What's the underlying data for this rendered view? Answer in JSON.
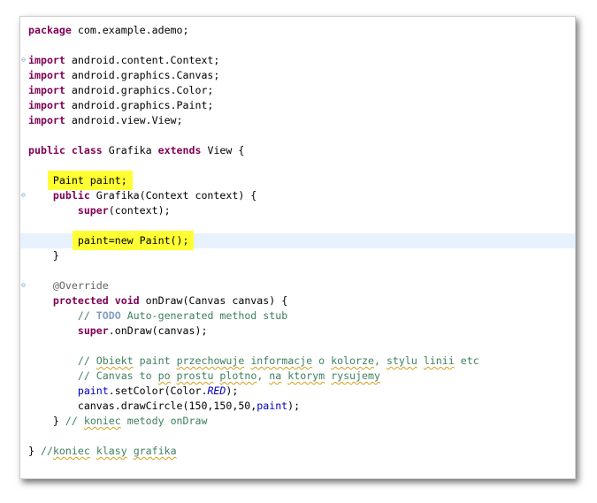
{
  "editor": {
    "lines": [
      [
        {
          "t": "package",
          "c": "kw"
        },
        {
          "t": " com.example.ademo;"
        }
      ],
      [],
      [
        {
          "t": "import",
          "c": "kw"
        },
        {
          "t": " android.content.Context;"
        }
      ],
      [
        {
          "t": "import",
          "c": "kw"
        },
        {
          "t": " android.graphics.Canvas;"
        }
      ],
      [
        {
          "t": "import",
          "c": "kw"
        },
        {
          "t": " android.graphics.Color;"
        }
      ],
      [
        {
          "t": "import",
          "c": "kw"
        },
        {
          "t": " android.graphics.Paint;"
        }
      ],
      [
        {
          "t": "import",
          "c": "kw"
        },
        {
          "t": " android.view.View;"
        }
      ],
      [],
      [
        {
          "t": "public",
          "c": "kw"
        },
        {
          "t": " "
        },
        {
          "t": "class",
          "c": "kw"
        },
        {
          "t": " Grafika "
        },
        {
          "t": "extends",
          "c": "kw"
        },
        {
          "t": " View {"
        }
      ],
      [],
      [
        {
          "t": "    "
        },
        {
          "t": "Paint paint;",
          "c": "hl",
          "name": "highlight-paint-field"
        }
      ],
      [
        {
          "t": "    "
        },
        {
          "t": "public",
          "c": "kw"
        },
        {
          "t": " Grafika(Context context) {"
        }
      ],
      [
        {
          "t": "        "
        },
        {
          "t": "super",
          "c": "kw"
        },
        {
          "t": "(context);"
        }
      ],
      [],
      [
        {
          "t": "        "
        },
        {
          "t": "paint=new Paint();",
          "c": "hl",
          "name": "highlight-paint-init"
        }
      ],
      [
        {
          "t": "    }"
        }
      ],
      [],
      [
        {
          "t": "    "
        },
        {
          "t": "@Override",
          "c": "an"
        }
      ],
      [
        {
          "t": "    "
        },
        {
          "t": "protected",
          "c": "kw"
        },
        {
          "t": " "
        },
        {
          "t": "void",
          "c": "kw"
        },
        {
          "t": " onDraw(Canvas canvas) {"
        }
      ],
      [
        {
          "t": "        "
        },
        {
          "t": "// ",
          "c": "cm"
        },
        {
          "t": "TODO",
          "c": "todo"
        },
        {
          "t": " Auto-generated method stub",
          "c": "cm"
        }
      ],
      [
        {
          "t": "        "
        },
        {
          "t": "super",
          "c": "kw"
        },
        {
          "t": ".onDraw(canvas);"
        }
      ],
      [],
      [
        {
          "t": "        "
        },
        {
          "t": "// ",
          "c": "cm"
        },
        {
          "t": "Obiekt",
          "c": "cm sq"
        },
        {
          "t": " paint ",
          "c": "cm"
        },
        {
          "t": "przechowuje",
          "c": "cm sq"
        },
        {
          "t": " ",
          "c": "cm"
        },
        {
          "t": "informacje",
          "c": "cm sq"
        },
        {
          "t": " o ",
          "c": "cm"
        },
        {
          "t": "kolorze",
          "c": "cm sq"
        },
        {
          "t": ", ",
          "c": "cm"
        },
        {
          "t": "stylu",
          "c": "cm sq"
        },
        {
          "t": " ",
          "c": "cm"
        },
        {
          "t": "linii",
          "c": "cm sq"
        },
        {
          "t": " etc",
          "c": "cm"
        }
      ],
      [
        {
          "t": "        "
        },
        {
          "t": "// Canvas to ",
          "c": "cm"
        },
        {
          "t": "po",
          "c": "cm sq"
        },
        {
          "t": " ",
          "c": "cm"
        },
        {
          "t": "prostu",
          "c": "cm sq"
        },
        {
          "t": " ",
          "c": "cm"
        },
        {
          "t": "plotno",
          "c": "cm sq"
        },
        {
          "t": ", ",
          "c": "cm"
        },
        {
          "t": "na",
          "c": "cm sq"
        },
        {
          "t": " ",
          "c": "cm"
        },
        {
          "t": "ktorym",
          "c": "cm sq"
        },
        {
          "t": " ",
          "c": "cm"
        },
        {
          "t": "rysujemy",
          "c": "cm sq"
        }
      ],
      [
        {
          "t": "        "
        },
        {
          "t": "paint",
          "c": "fld"
        },
        {
          "t": ".setColor(Color."
        },
        {
          "t": "RED",
          "c": "cst"
        },
        {
          "t": ");"
        }
      ],
      [
        {
          "t": "        canvas.drawCircle(150,150,50,"
        },
        {
          "t": "paint",
          "c": "fld"
        },
        {
          "t": ");"
        }
      ],
      [
        {
          "t": "    } "
        },
        {
          "t": "// ",
          "c": "cm"
        },
        {
          "t": "koniec",
          "c": "cm sq"
        },
        {
          "t": " metody onDraw",
          "c": "cm"
        }
      ],
      [],
      [
        {
          "t": "} "
        },
        {
          "t": "//",
          "c": "cm"
        },
        {
          "t": "koniec",
          "c": "cm sq"
        },
        {
          "t": " ",
          "c": "cm"
        },
        {
          "t": "klasy",
          "c": "cm sq"
        },
        {
          "t": " ",
          "c": "cm"
        },
        {
          "t": "grafika",
          "c": "cm sq"
        }
      ]
    ],
    "current_line": 14,
    "fold_markers": [
      2,
      11,
      17
    ],
    "fold_marker_glyph": "⊖",
    "colors": {
      "keyword": "#7f0055",
      "comment": "#3f7f5f",
      "annotation": "#646464",
      "field": "#0000c0",
      "highlight": "#ffff33",
      "current_line": "#e8f2fe"
    }
  }
}
